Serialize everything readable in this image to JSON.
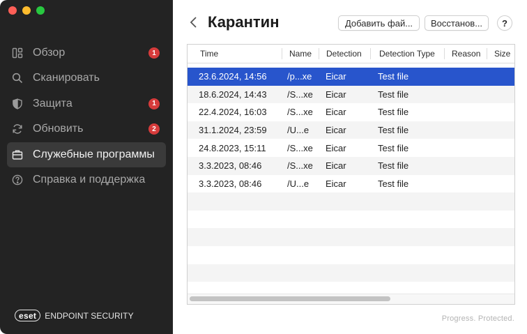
{
  "sidebar": {
    "items": [
      {
        "label": "Обзор",
        "icon": "dashboard-icon",
        "badge": "1",
        "active": false
      },
      {
        "label": "Сканировать",
        "icon": "search-icon",
        "badge": null,
        "active": false
      },
      {
        "label": "Защита",
        "icon": "shield-icon",
        "badge": "1",
        "active": false
      },
      {
        "label": "Обновить",
        "icon": "refresh-icon",
        "badge": "2",
        "active": false
      },
      {
        "label": "Служебные программы",
        "icon": "briefcase-icon",
        "badge": null,
        "active": true
      },
      {
        "label": "Справка и поддержка",
        "icon": "help-circle-icon",
        "badge": null,
        "active": false
      }
    ],
    "brand_logo": "eset",
    "brand_text": "ENDPOINT SECURITY"
  },
  "header": {
    "title": "Карантин",
    "add_button": "Добавить фай...",
    "restore_button": "Восстанов...",
    "help_button": "?"
  },
  "table": {
    "columns": [
      "Time",
      "Name",
      "Detection",
      "Detection Type",
      "Reason",
      "Size"
    ],
    "rows": [
      {
        "time": "23.6.2024, 14:56",
        "name": "/p...xe",
        "detection": "Eicar",
        "type": "Test file",
        "selected": true
      },
      {
        "time": "18.6.2024, 14:43",
        "name": "/S...xe",
        "detection": "Eicar",
        "type": "Test file",
        "selected": false
      },
      {
        "time": "22.4.2024, 16:03",
        "name": "/S...xe",
        "detection": "Eicar",
        "type": "Test file",
        "selected": false
      },
      {
        "time": "31.1.2024, 23:59",
        "name": "/U...e",
        "detection": "Eicar",
        "type": "Test file",
        "selected": false
      },
      {
        "time": "24.8.2023, 15:11",
        "name": "/S...xe",
        "detection": "Eicar",
        "type": "Test file",
        "selected": false
      },
      {
        "time": "3.3.2023, 08:46",
        "name": "/S...xe",
        "detection": "Eicar",
        "type": "Test file",
        "selected": false
      },
      {
        "time": "3.3.2023, 08:46",
        "name": "/U...e",
        "detection": "Eicar",
        "type": "Test file",
        "selected": false
      }
    ],
    "empty_rows": 6
  },
  "footer": {
    "tagline": "Progress. Protected."
  },
  "colors": {
    "sidebar_bg": "#232323",
    "selection": "#2855cc",
    "badge": "#d63b3b"
  }
}
